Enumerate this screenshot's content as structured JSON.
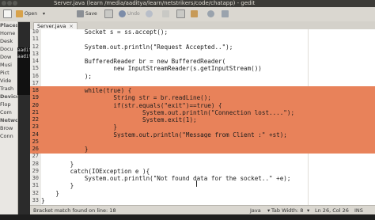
{
  "window": {
    "title": "Server.java (learn /media/aaditya/learn/netstrikers/code/chatapp) - gedit"
  },
  "toolbar": {
    "open_label": "Open",
    "save_label": "Save",
    "undo_label": "Undo"
  },
  "sidebar": {
    "places_header": "Places",
    "items": [
      "Home",
      "Desk",
      "Docu",
      "Dow",
      "Musi",
      "Pict",
      "Vide",
      "Trash"
    ],
    "devices_header": "Devices",
    "devices": [
      "Flop",
      "Com"
    ],
    "network_header": "Networ",
    "network": [
      "Brow",
      "Conn"
    ]
  },
  "terminal": {
    "lines": [
      "aadit",
      "aadit"
    ]
  },
  "tabs": [
    {
      "label": "Server.java"
    }
  ],
  "editor": {
    "lines": [
      {
        "num": "10",
        "code": "            Socket s = ss.accept();",
        "selected": false
      },
      {
        "num": "11",
        "code": "",
        "selected": false
      },
      {
        "num": "12",
        "code": "            System.out.println(\"Request Accepted..\");",
        "selected": false
      },
      {
        "num": "13",
        "code": "",
        "selected": false
      },
      {
        "num": "14",
        "code": "            BufferedReader br = new BufferedReader(",
        "selected": false
      },
      {
        "num": "15",
        "code": "                    new InputStreamReader(s.getInputStream())",
        "selected": false
      },
      {
        "num": "16",
        "code": "            );",
        "selected": false
      },
      {
        "num": "17",
        "code": "",
        "selected": false
      },
      {
        "num": "18",
        "code": "            while(true) {",
        "selected": true
      },
      {
        "num": "19",
        "code": "                    String str = br.readLine();",
        "selected": true
      },
      {
        "num": "20",
        "code": "                    if(str.equals(\"exit\")==true) {",
        "selected": true
      },
      {
        "num": "21",
        "code": "                            System.out.println(\"Connection lost....\");",
        "selected": true
      },
      {
        "num": "22",
        "code": "                            System.exit(1);",
        "selected": true
      },
      {
        "num": "23",
        "code": "                    }",
        "selected": true
      },
      {
        "num": "24",
        "code": "                    System.out.println(\"Message from Client :\" +st);",
        "selected": true
      },
      {
        "num": "25",
        "code": "",
        "selected": true
      },
      {
        "num": "26",
        "code": "            }",
        "selected": true
      },
      {
        "num": "27",
        "code": "",
        "selected": false
      },
      {
        "num": "28",
        "code": "        }",
        "selected": false
      },
      {
        "num": "29",
        "code": "        catch(IOException e ){",
        "selected": false
      },
      {
        "num": "30",
        "code": "            System.out.println(\"Not found data for the socket..\" +e);",
        "selected": false
      },
      {
        "num": "31",
        "code": "        }",
        "selected": false
      },
      {
        "num": "32",
        "code": "    }",
        "selected": false
      },
      {
        "num": "33",
        "code": "}",
        "selected": false
      }
    ]
  },
  "status": {
    "message": "Bracket match found on line: 18",
    "language": "Java",
    "tab_width": "Tab Width: 8",
    "position": "Ln 26, Col 26",
    "mode": "INS"
  },
  "colors": {
    "selection": "#e8825a",
    "titlebar": "#3c3b37"
  }
}
